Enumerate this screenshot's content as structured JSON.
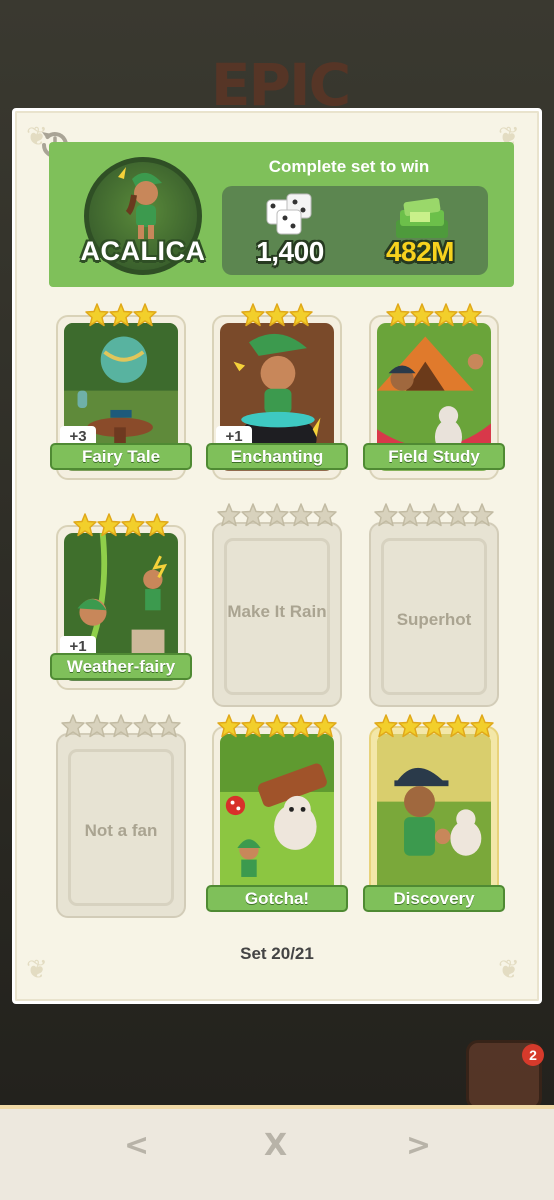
{
  "background_title": "EPIC",
  "set": {
    "name": "ACALICA",
    "complete_text": "Complete set to win",
    "rewards": {
      "dice": "1,400",
      "cash": "482M"
    },
    "progress": "Set 20/21"
  },
  "cards": [
    {
      "name": "Fairy Tale",
      "stars": 3,
      "count_badge": "+3",
      "collected": true
    },
    {
      "name": "Enchanting",
      "stars": 3,
      "count_badge": "+1",
      "collected": true
    },
    {
      "name": "Field Study",
      "stars": 4,
      "count_badge": "",
      "collected": true
    },
    {
      "name": "Weather-fairy",
      "stars": 4,
      "count_badge": "+1",
      "collected": true
    },
    {
      "name": "Make It Rain",
      "stars": 5,
      "count_badge": "",
      "collected": false
    },
    {
      "name": "Superhot",
      "stars": 5,
      "count_badge": "",
      "collected": false
    },
    {
      "name": "Not a fan",
      "stars": 5,
      "count_badge": "",
      "collected": false
    },
    {
      "name": "Gotcha!",
      "stars": 5,
      "count_badge": "",
      "collected": true
    },
    {
      "name": "Discovery",
      "stars": 5,
      "count_badge": "",
      "collected": true
    }
  ],
  "nav": {
    "prev": "<",
    "close": "X",
    "next": ">"
  },
  "notification_count": "2",
  "colors": {
    "header_green": "#7fc05a",
    "star_gold": "#f2cf2b",
    "cash_yellow": "#f7d21e"
  }
}
